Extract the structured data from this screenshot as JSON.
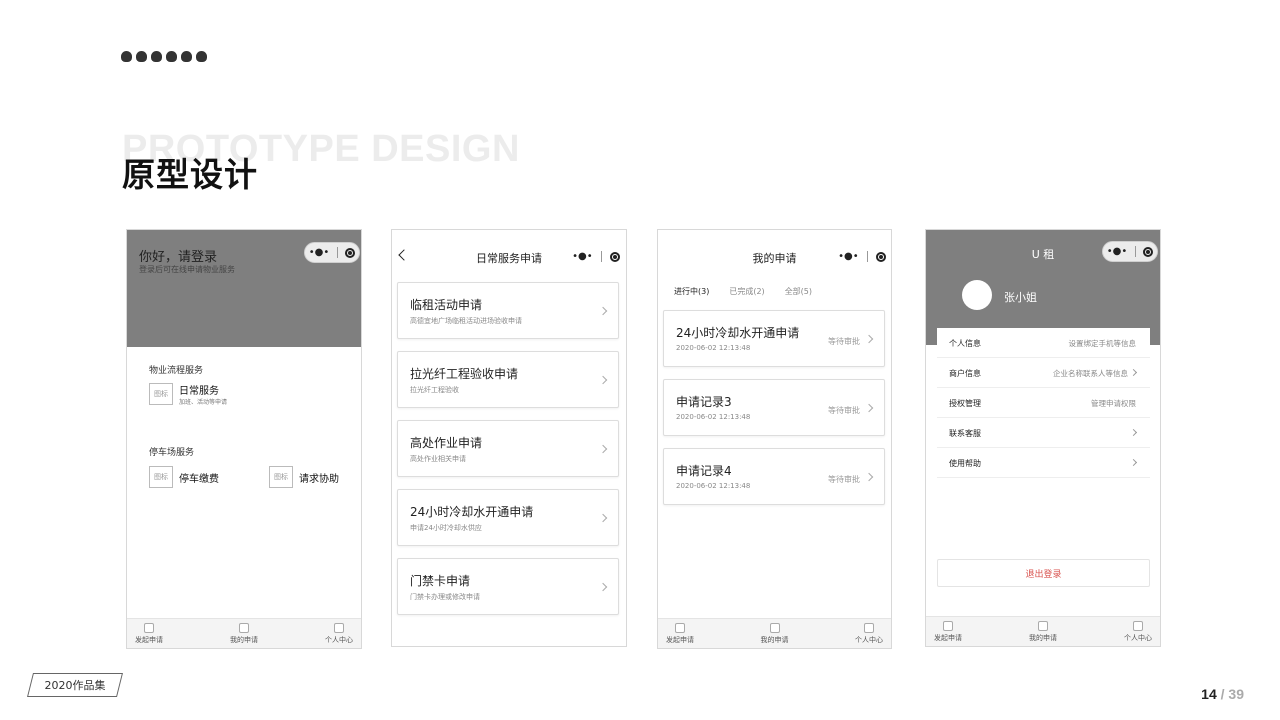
{
  "slide": {
    "bg_title": "PROTOTYPE DESIGN",
    "title": "原型设计",
    "footer_tag": "2020作品集",
    "page_current": "14",
    "page_sep": "/",
    "page_total": "39"
  },
  "tabbar": [
    "发起申请",
    "我的申请",
    "个人中心"
  ],
  "phone1": {
    "greeting": "你好，请登录",
    "subtitle": "登录后可在线申请物业服务",
    "section1": "物业流程服务",
    "icon_text": "图标",
    "daily_label": "日常服务",
    "daily_desc": "加班、活动等申请",
    "section2": "停车场服务",
    "parking_label": "停车缴费",
    "help_label": "请求协助"
  },
  "phone2": {
    "title": "日常服务申请",
    "cards": [
      {
        "title": "临租活动申请",
        "desc": "高德宜地广场临租活动进场验收申请"
      },
      {
        "title": "拉光纤工程验收申请",
        "desc": "拉光纤工程验收"
      },
      {
        "title": "高处作业申请",
        "desc": "高处作业相关申请"
      },
      {
        "title": "24小时冷却水开通申请",
        "desc": "申请24小时冷却水供应"
      },
      {
        "title": "门禁卡申请",
        "desc": "门禁卡办理或修改申请"
      }
    ]
  },
  "phone3": {
    "title": "我的申请",
    "tabs": [
      "进行中(3)",
      "已完成(2)",
      "全部(5)"
    ],
    "cards": [
      {
        "title": "24小时冷却水开通申请",
        "time": "2020-06-02  12:13:48",
        "status": "等待审批"
      },
      {
        "title": "申请记录3",
        "time": "2020-06-02  12:13:48",
        "status": "等待审批"
      },
      {
        "title": "申请记录4",
        "time": "2020-06-02  12:13:48",
        "status": "等待审批"
      }
    ]
  },
  "phone4": {
    "title": "U 租",
    "username": "张小姐",
    "rows": [
      {
        "label": "个人信息",
        "value": "设置绑定手机等信息"
      },
      {
        "label": "商户信息",
        "value": "企业名称联系人等信息"
      },
      {
        "label": "授权管理",
        "value": "管理申请权限"
      },
      {
        "label": "联系客服",
        "value": ""
      },
      {
        "label": "使用帮助",
        "value": ""
      }
    ],
    "logout": "退出登录"
  }
}
